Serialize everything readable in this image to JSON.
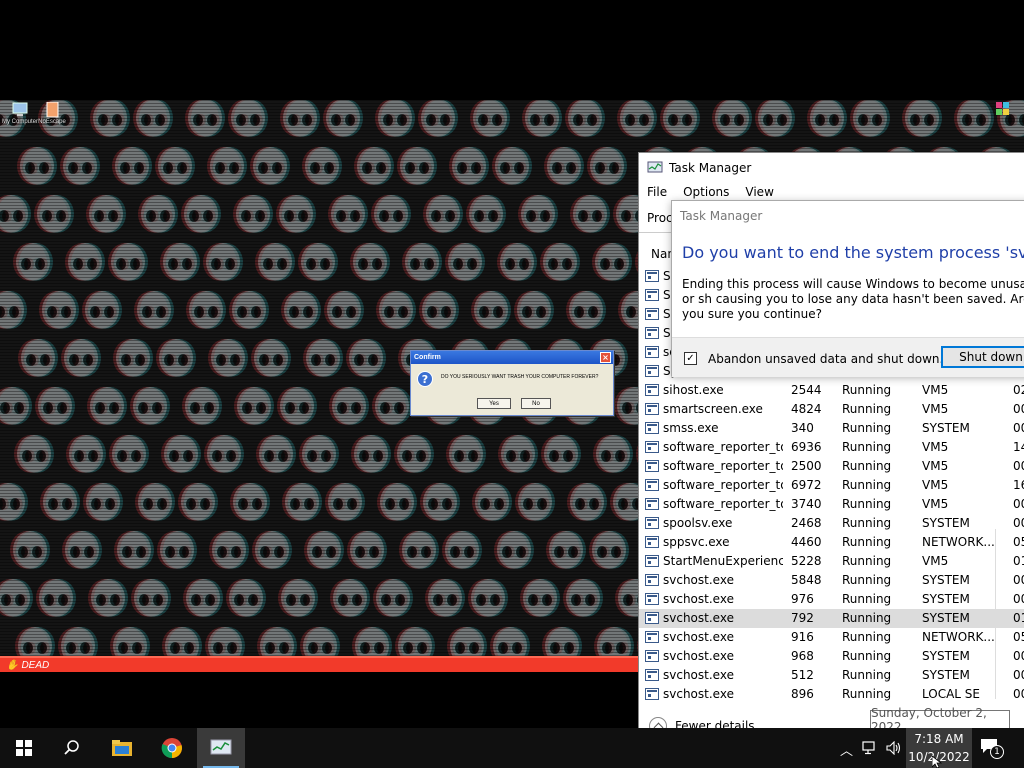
{
  "desktop": {
    "icons": [
      {
        "label": "My Computer",
        "icon": "computer-icon"
      },
      {
        "label": "NoEscape",
        "icon": "document-icon"
      }
    ],
    "bottom_bar_label": "DEAD"
  },
  "confirm_dialog": {
    "title": "Confirm",
    "message": "DO YOU SERIOUSLY WANT TRASH YOUR COMPUTER FOREVER?",
    "yes_label": "Yes",
    "no_label": "No"
  },
  "task_manager": {
    "title": "Task Manager",
    "menu": [
      "File",
      "Options",
      "View"
    ],
    "tab_label": "Proc",
    "column_header": "Nan",
    "partial_rows": [
      "Se",
      "Se",
      "Se",
      "Se",
      "se",
      "Sy"
    ],
    "rows": [
      {
        "name": "sihost.exe",
        "pid": "2544",
        "status": "Running",
        "user": "VM5",
        "cpu": "02"
      },
      {
        "name": "smartscreen.exe",
        "pid": "4824",
        "status": "Running",
        "user": "VM5",
        "cpu": "00"
      },
      {
        "name": "smss.exe",
        "pid": "340",
        "status": "Running",
        "user": "SYSTEM",
        "cpu": "00"
      },
      {
        "name": "software_reporter_to...",
        "pid": "6936",
        "status": "Running",
        "user": "VM5",
        "cpu": "14"
      },
      {
        "name": "software_reporter_to...",
        "pid": "2500",
        "status": "Running",
        "user": "VM5",
        "cpu": "00"
      },
      {
        "name": "software_reporter_to...",
        "pid": "6972",
        "status": "Running",
        "user": "VM5",
        "cpu": "16"
      },
      {
        "name": "software_reporter_to...",
        "pid": "3740",
        "status": "Running",
        "user": "VM5",
        "cpu": "00"
      },
      {
        "name": "spoolsv.exe",
        "pid": "2468",
        "status": "Running",
        "user": "SYSTEM",
        "cpu": "00"
      },
      {
        "name": "sppsvc.exe",
        "pid": "4460",
        "status": "Running",
        "user": "NETWORK...",
        "cpu": "05"
      },
      {
        "name": "StartMenuExperienc...",
        "pid": "5228",
        "status": "Running",
        "user": "VM5",
        "cpu": "01"
      },
      {
        "name": "svchost.exe",
        "pid": "5848",
        "status": "Running",
        "user": "SYSTEM",
        "cpu": "00"
      },
      {
        "name": "svchost.exe",
        "pid": "976",
        "status": "Running",
        "user": "SYSTEM",
        "cpu": "00"
      },
      {
        "name": "svchost.exe",
        "pid": "792",
        "status": "Running",
        "user": "SYSTEM",
        "cpu": "01",
        "selected": true
      },
      {
        "name": "svchost.exe",
        "pid": "916",
        "status": "Running",
        "user": "NETWORK...",
        "cpu": "05"
      },
      {
        "name": "svchost.exe",
        "pid": "968",
        "status": "Running",
        "user": "SYSTEM",
        "cpu": "00"
      },
      {
        "name": "svchost.exe",
        "pid": "512",
        "status": "Running",
        "user": "SYSTEM",
        "cpu": "00"
      },
      {
        "name": "svchost.exe",
        "pid": "896",
        "status": "Running",
        "user": "LOCAL SE",
        "cpu": "00"
      }
    ],
    "fewer_details_label": "Fewer details",
    "date_tooltip": "Sunday, October 2, 2022"
  },
  "end_process_dialog": {
    "title": "Task Manager",
    "heading": "Do you want to end the system process 'svchost.e",
    "body": "Ending this process will cause Windows to become unusable or sh causing you to lose any data hasn't been saved. Are you sure you continue?",
    "checkbox_label": "Abandon unsaved data and shut down.",
    "checkbox_checked": true,
    "shutdown_label": "Shut down"
  },
  "taskbar": {
    "time": "7:18 AM",
    "date": "10/2/2022",
    "notification_count": "1"
  }
}
